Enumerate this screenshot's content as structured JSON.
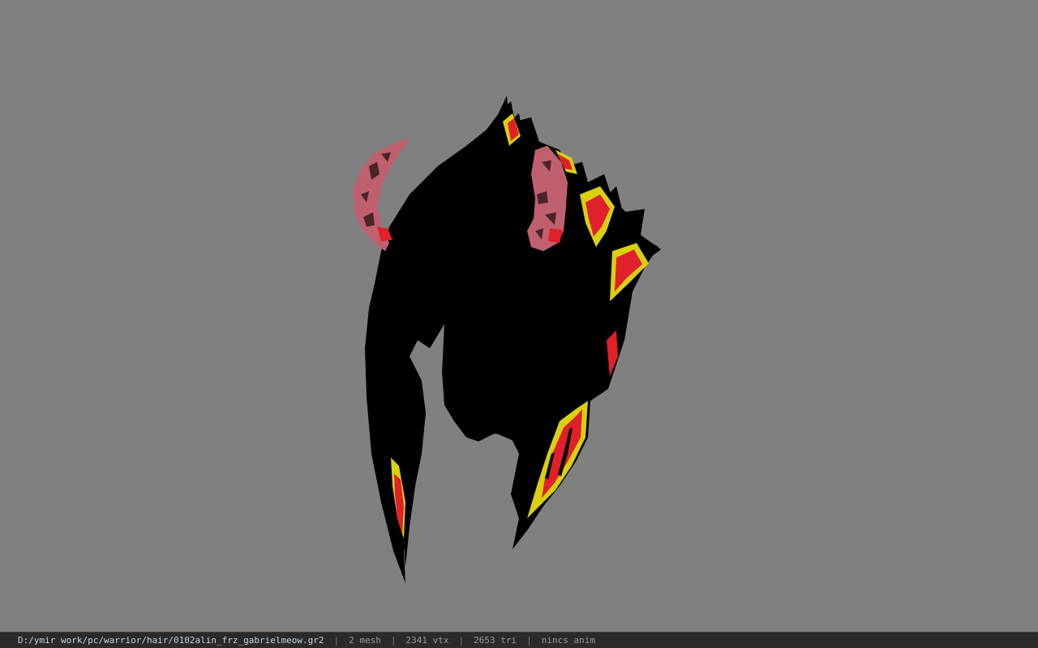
{
  "viewer": {
    "background_color": "#808080",
    "model_colors": {
      "hair": "#000000",
      "horn": "#c0606e",
      "flame_red": "#e0202a",
      "flame_yellow": "#d8d010"
    }
  },
  "status_bar": {
    "file_path": "D:/ymir work/pc/warrior/hair/0102alin_frz_gabrielmeow.gr2",
    "separator": "|",
    "mesh_count": "2 mesh",
    "vertex_count": "2341 vtx",
    "triangle_count": "2653 tri",
    "animation_status": "nincs anim"
  }
}
